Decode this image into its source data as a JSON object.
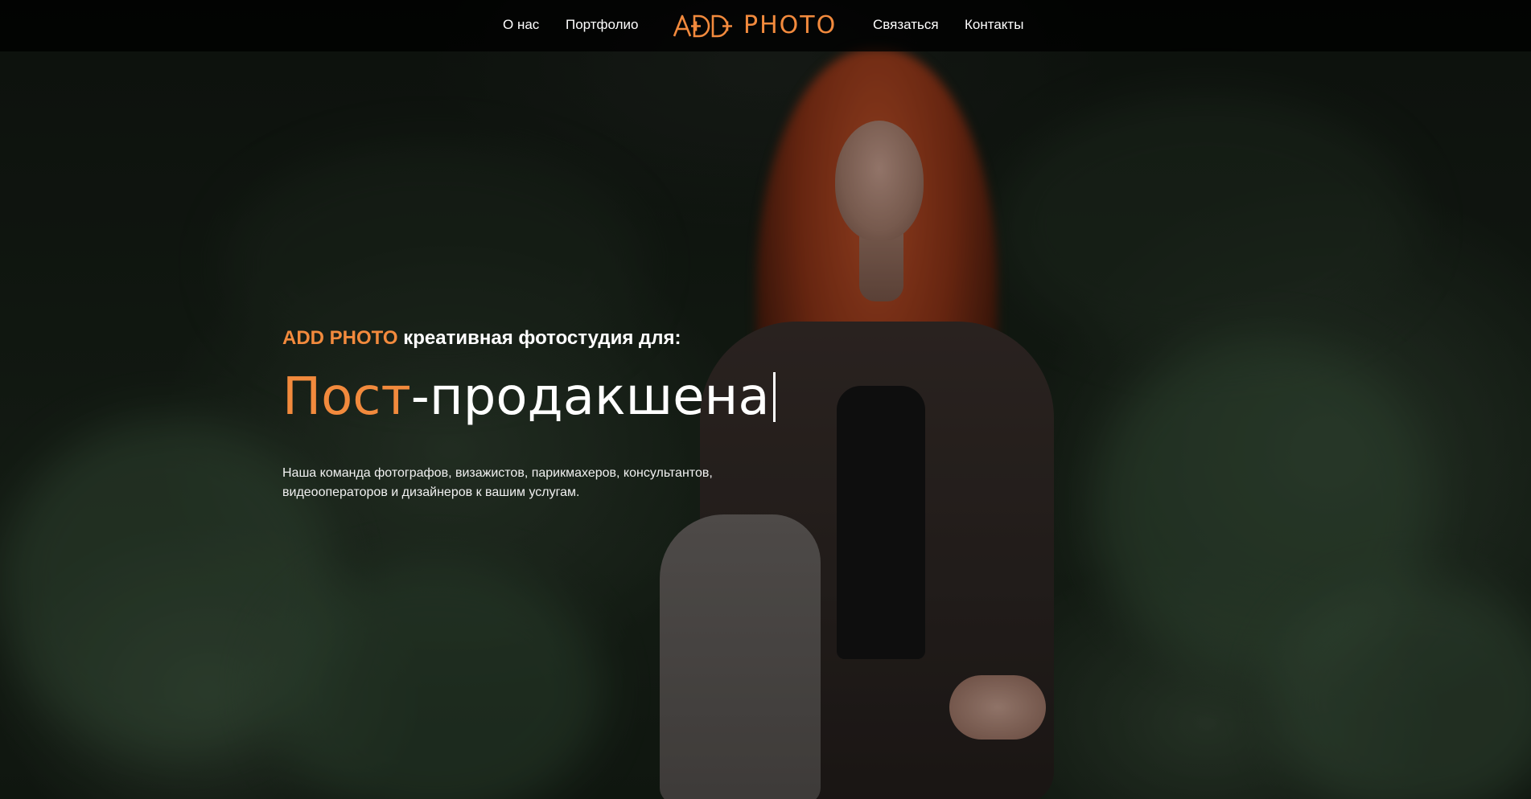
{
  "nav": {
    "about": "О нас",
    "portfolio": "Портфолио",
    "contact_us": "Связаться",
    "contacts": "Контакты"
  },
  "logo": {
    "text": "PHOTO",
    "icon": "add-logo-icon",
    "color": "#f28a3d"
  },
  "hero": {
    "tagline_brand": "ADD PHOTO",
    "tagline_rest": "креативная фотостудия для:",
    "headline_orange": "Пост",
    "headline_white": "-продакшена",
    "description_line1": "Наша команда фотографов, визажистов, парикмахеров, консультантов,",
    "description_line2": "видеооператоров и дизайнеров к вашим услугам."
  },
  "colors": {
    "accent": "#f28a3d",
    "navbar_bg": "#000000",
    "text": "#ffffff"
  }
}
